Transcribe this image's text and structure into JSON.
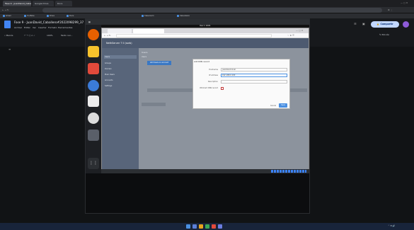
{
  "host_browser": {
    "tabs": [
      {
        "label": "Fase 9 - JuanDavid_Caballero"
      },
      {
        "label": "Google Drive"
      },
      {
        "label": "Docs"
      }
    ],
    "bookmarks": [
      "Gmail",
      "YouTube",
      "Drive",
      "Docs",
      "Classroom",
      "Calendario"
    ]
  },
  "docs": {
    "title": "Fase 9 - JuanDavid_Caballero#2022098299_37",
    "menu": [
      "Archivo",
      "Editar",
      "Ver",
      "Insertar",
      "Formato",
      "Herramientas"
    ],
    "toolbar": {
      "search": "Menús",
      "zoom": "100%",
      "style": "Texto nor..."
    },
    "share_label": "Compartir",
    "edit_mode": "Edición"
  },
  "vm": {
    "guest_clock": "Dec 1 19:01",
    "app_title": "NethServer 7 ll (sorb)",
    "sidebar": [
      "Users",
      "Groups",
      "Domain",
      "Plain Users",
      "Accounts",
      "Settings"
    ],
    "tabs": [
      "Users",
      "Groups"
    ],
    "page_heading": "Users",
    "action_label": "Add Users on account"
  },
  "modal": {
    "title": "Add DNS record",
    "fields": [
      {
        "label": "Hostname",
        "value": "juandavid.local"
      },
      {
        "label": "IP address",
        "value": "192.168.0.100"
      },
      {
        "label": "Description",
        "value": ""
      },
      {
        "label": "Wildcard DNS record",
        "value": ""
      }
    ],
    "cancel_label": "Cancel",
    "save_label": "Save"
  },
  "colors": {
    "accent": "#4a90e2",
    "share_bg": "#c2d7ff",
    "app_header": "#4d5a70"
  }
}
